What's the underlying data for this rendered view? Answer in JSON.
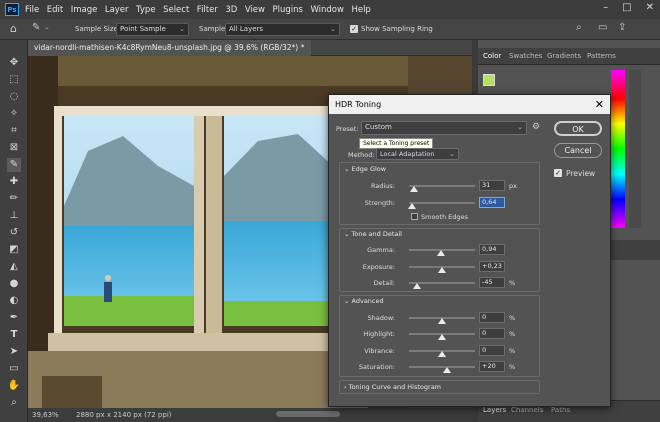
{
  "menubar": {
    "logo": "Ps",
    "items": [
      "File",
      "Edit",
      "Image",
      "Layer",
      "Type",
      "Select",
      "Filter",
      "3D",
      "View",
      "Plugins",
      "Window",
      "Help"
    ],
    "window_controls": [
      "–",
      "□",
      "✕"
    ]
  },
  "options": {
    "sample_size_label": "Sample Size:",
    "sample_size_value": "Point Sample",
    "sample_label": "Sample:",
    "sample_value": "All Layers",
    "show_ring_label": "Show Sampling Ring"
  },
  "document": {
    "tab_title": "vidar-nordli-mathisen-K4c8RymNeu8-unsplash.jpg @ 39,6% (RGB/32*) *",
    "zoom": "39,63%",
    "dimensions": "2880 px x 2140 px (72 ppi)"
  },
  "panels": {
    "top_tabs": [
      "Color",
      "Swatches",
      "Gradients",
      "Patterns"
    ],
    "bottom_tabs": [
      "Layers",
      "Channels",
      "Paths"
    ]
  },
  "dialog": {
    "title": "HDR Toning",
    "preset_label": "Preset:",
    "preset_value": "Custom",
    "tooltip": "Select a Toning preset",
    "method_label": "Method:",
    "method_value": "Local Adaptation",
    "ok_label": "OK",
    "cancel_label": "Cancel",
    "preview_label": "Preview",
    "edge_glow": {
      "title": "Edge Glow",
      "radius_label": "Radius:",
      "radius_value": "31",
      "radius_unit": "px",
      "radius_pos": 0.08,
      "strength_label": "Strength:",
      "strength_value": "0,64",
      "strength_pos": 0.05,
      "smooth_label": "Smooth Edges"
    },
    "tone_detail": {
      "title": "Tone and Detail",
      "gamma_label": "Gamma:",
      "gamma_value": "0,94",
      "gamma_pos": 0.48,
      "exposure_label": "Exposure:",
      "exposure_value": "+0,23",
      "exposure_pos": 0.5,
      "detail_label": "Detail:",
      "detail_value": "-45",
      "detail_unit": "%",
      "detail_pos": 0.12
    },
    "advanced": {
      "title": "Advanced",
      "shadow_label": "Shadow:",
      "shadow_value": "0",
      "shadow_pos": 0.5,
      "highlight_label": "Highlight:",
      "highlight_value": "0",
      "highlight_pos": 0.5,
      "vibrance_label": "Vibrance:",
      "vibrance_value": "0",
      "vibrance_pos": 0.5,
      "saturation_label": "Saturation:",
      "saturation_value": "+20",
      "saturation_pos": 0.58,
      "pct": "%"
    },
    "toning_curve_label": "Toning Curve and Histogram"
  },
  "colors": {
    "accent": "#31a8ff",
    "foreground_swatch": "#b7e060",
    "ps_logo_bg": "#0f1e36"
  }
}
